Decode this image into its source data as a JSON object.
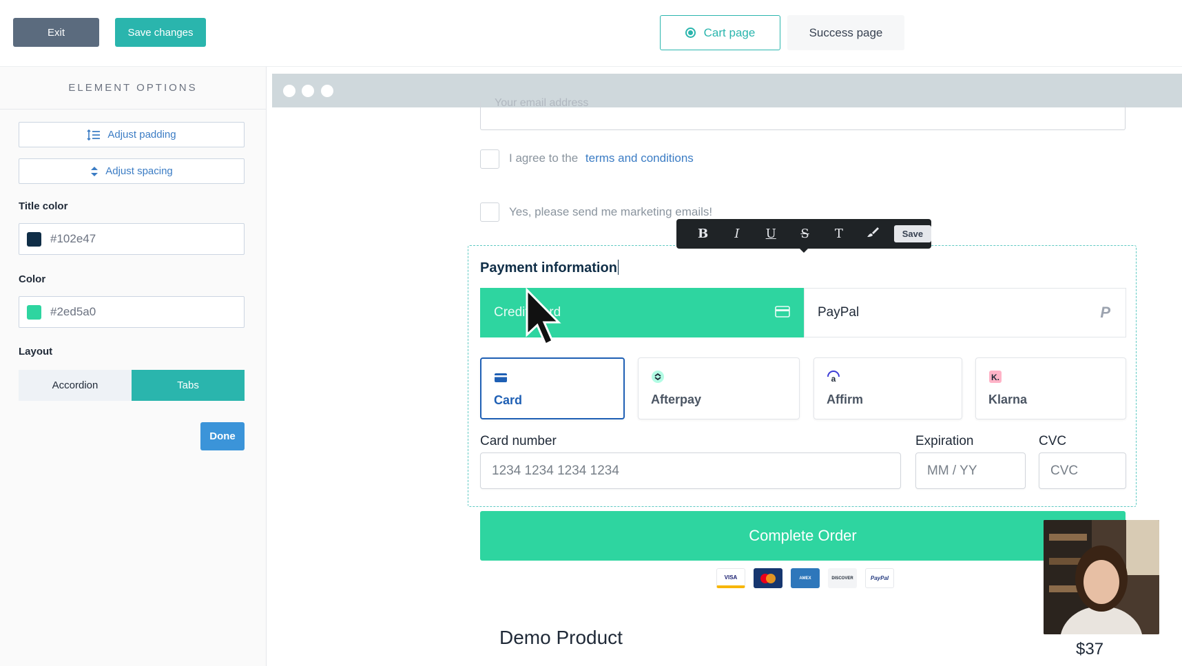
{
  "topbar": {
    "exit_label": "Exit",
    "save_label": "Save changes",
    "tabs": [
      {
        "label": "Cart page",
        "active": true
      },
      {
        "label": "Success page",
        "active": false
      }
    ]
  },
  "sidebar": {
    "title": "ELEMENT OPTIONS",
    "adjust_padding": "Adjust padding",
    "adjust_spacing": "Adjust spacing",
    "title_color_label": "Title color",
    "title_color_value": "#102e47",
    "color_label": "Color",
    "color_value": "#2ed5a0",
    "layout_label": "Layout",
    "layout_options": [
      "Accordion",
      "Tabs"
    ],
    "layout_selected": "Tabs",
    "done_label": "Done"
  },
  "preview": {
    "email_placeholder": "Your email address",
    "agree_text": "I agree to the",
    "terms_link": "terms and conditions",
    "marketing_text": "Yes, please send me marketing emails!",
    "format_toolbar": {
      "buttons": [
        "B",
        "I",
        "U",
        "S",
        "T",
        "brush"
      ],
      "save_label": "Save"
    },
    "payment_title": "Payment information",
    "tabs": [
      {
        "label": "Credit Card",
        "icon": "credit-card-icon",
        "active": true
      },
      {
        "label": "PayPal",
        "icon": "paypal-icon",
        "active": false
      }
    ],
    "methods": [
      {
        "label": "Card",
        "icon": "card-icon",
        "selected": true
      },
      {
        "label": "Afterpay",
        "icon": "afterpay-icon",
        "selected": false
      },
      {
        "label": "Affirm",
        "icon": "affirm-icon",
        "selected": false
      },
      {
        "label": "Klarna",
        "icon": "klarna-icon",
        "selected": false
      }
    ],
    "card_number_label": "Card number",
    "card_number_placeholder": "1234 1234 1234 1234",
    "expiration_label": "Expiration",
    "expiration_placeholder": "MM / YY",
    "cvc_label": "CVC",
    "cvc_placeholder": "CVC",
    "complete_order_label": "Complete Order",
    "card_brands": [
      "VISA",
      "Mastercard",
      "American Express",
      "DISCOVER",
      "PayPal"
    ],
    "product_name": "Demo Product",
    "price": "$37"
  },
  "colors": {
    "accent_teal": "#2ab5ad",
    "payment_green": "#2ed5a0",
    "title_navy": "#102e47",
    "link_blue": "#3b7cc4",
    "done_blue": "#3b94d9",
    "exit_gray": "#5b6b7e"
  }
}
